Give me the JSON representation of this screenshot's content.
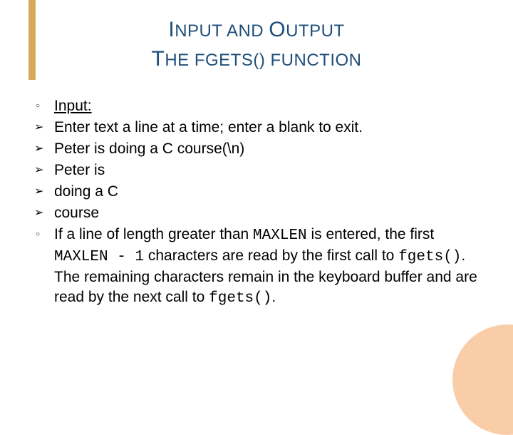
{
  "title": {
    "line1": {
      "cap1": "I",
      "rest1": "NPUT AND ",
      "cap2": "O",
      "rest2": "UTPUT"
    },
    "line2": {
      "cap1": "T",
      "rest1": "HE FGETS",
      "paren": "()",
      "rest2": " FUNCTION"
    }
  },
  "items": [
    {
      "bullet": "circle",
      "underline": true,
      "text": "Input:"
    },
    {
      "bullet": "arrow",
      "text": "Enter text a line at a time; enter a blank to exit."
    },
    {
      "bullet": "arrow",
      "text": "Peter is doing a C course(\\n)"
    },
    {
      "bullet": "arrow",
      "text": "Peter is"
    },
    {
      "bullet": "arrow",
      "text": "doing a C"
    },
    {
      "bullet": "arrow",
      "text": "course"
    },
    {
      "bullet": "circle",
      "segments": [
        {
          "t": "If a line of length greater than "
        },
        {
          "t": "MAXLEN",
          "mono": true
        },
        {
          "t": " is entered, the first "
        },
        {
          "t": "MAXLEN - 1",
          "mono": true
        },
        {
          "t": " characters are read by the first call to "
        },
        {
          "t": "fgets()",
          "mono": true
        },
        {
          "t": ". The remaining characters remain in the keyboard buffer and are read by the next call to "
        },
        {
          "t": "fgets()",
          "mono": true
        },
        {
          "t": "."
        }
      ]
    }
  ]
}
